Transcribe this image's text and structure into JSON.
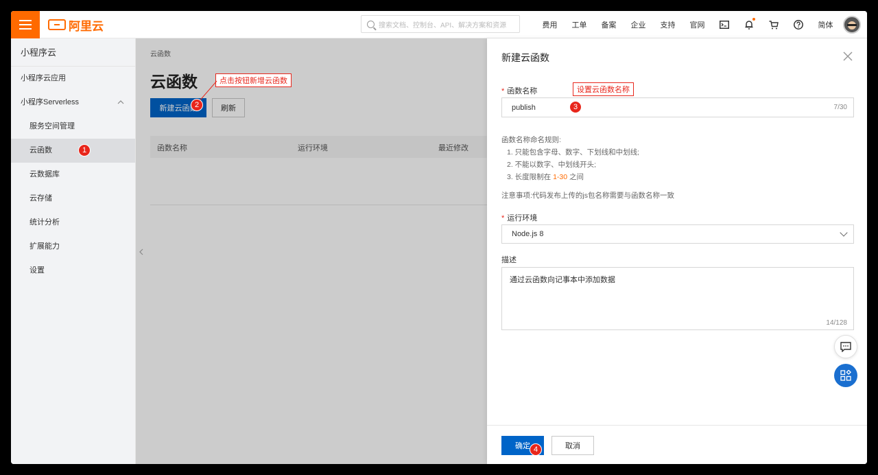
{
  "topbar": {
    "logo_text": "阿里云",
    "search_placeholder": "搜索文档、控制台、API、解决方案和资源",
    "nav": [
      "费用",
      "工单",
      "备案",
      "企业",
      "支持",
      "官网"
    ],
    "lang": "简体",
    "icons": [
      "terminal-icon",
      "bell-icon",
      "cart-icon",
      "help-icon"
    ]
  },
  "sidebar": {
    "title": "小程序云",
    "items": [
      {
        "label": "小程序云应用"
      },
      {
        "label": "小程序Serverless"
      },
      {
        "label": "服务空间管理"
      },
      {
        "label": "云函数"
      },
      {
        "label": "云数据库"
      },
      {
        "label": "云存储"
      },
      {
        "label": "统计分析"
      },
      {
        "label": "扩展能力"
      },
      {
        "label": "设置"
      }
    ]
  },
  "main": {
    "breadcrumb": "云函数",
    "title": "云函数",
    "new_button": "新建云函数",
    "refresh_button": "刷新",
    "columns": [
      "函数名称",
      "运行环境",
      "最近修改"
    ]
  },
  "annotations": {
    "step1": "1",
    "step2": "2",
    "step3": "3",
    "step4": "4",
    "tip_new": "点击按钮新增云函数",
    "tip_name": "设置云函数名称"
  },
  "drawer": {
    "title": "新建云函数",
    "name_label": "函数名称",
    "name_value": "publish",
    "name_count": "7/30",
    "rules_title": "函数名称命名规则:",
    "rule1": "1. 只能包含字母、数字、下划线和中划线;",
    "rule2": "2. 不能以数字、中划线开头;",
    "rule3_prefix": "3. 长度限制在 ",
    "rule3_range": "1-30",
    "rule3_suffix": " 之间",
    "note": "注意事项:代码发布上传的js包名称需要与函数名称一致",
    "runtime_label": "运行环境",
    "runtime_value": "Node.js 8",
    "desc_label": "描述",
    "desc_value": "通过云函数向记事本中添加数据",
    "desc_count": "14/128",
    "confirm": "确定",
    "cancel": "取消"
  },
  "colors": {
    "brand": "#ff6a00",
    "primary": "#0064c8",
    "annotation": "#e8261b"
  }
}
